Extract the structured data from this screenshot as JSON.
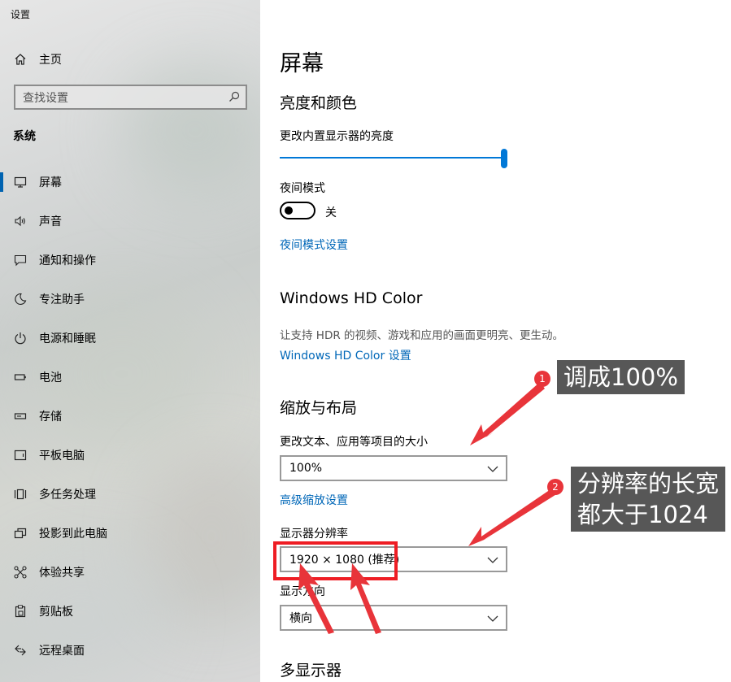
{
  "window": {
    "title": "设置"
  },
  "sidebar": {
    "home_label": "主页",
    "search_placeholder": "查找设置",
    "section_header": "系统",
    "items": [
      {
        "label": "屏幕",
        "icon": "monitor-icon",
        "active": true
      },
      {
        "label": "声音",
        "icon": "speaker-icon"
      },
      {
        "label": "通知和操作",
        "icon": "notification-icon"
      },
      {
        "label": "专注助手",
        "icon": "moon-icon"
      },
      {
        "label": "电源和睡眠",
        "icon": "power-icon"
      },
      {
        "label": "电池",
        "icon": "battery-icon"
      },
      {
        "label": "存储",
        "icon": "storage-icon"
      },
      {
        "label": "平板电脑",
        "icon": "tablet-icon"
      },
      {
        "label": "多任务处理",
        "icon": "multitasking-icon"
      },
      {
        "label": "投影到此电脑",
        "icon": "projection-icon"
      },
      {
        "label": "体验共享",
        "icon": "share-experience-icon"
      },
      {
        "label": "剪贴板",
        "icon": "clipboard-icon"
      },
      {
        "label": "远程桌面",
        "icon": "remote-desktop-icon"
      }
    ]
  },
  "main": {
    "title": "屏幕",
    "brightness": {
      "heading": "亮度和颜色",
      "label": "更改内置显示器的亮度",
      "value": 1.0
    },
    "night_light": {
      "label": "夜间模式",
      "state_label": "关",
      "settings_link": "夜间模式设置"
    },
    "hdr": {
      "heading": "Windows HD Color",
      "description": "让支持 HDR 的视频、游戏和应用的画面更明亮、更生动。",
      "link": "Windows HD Color 设置"
    },
    "scale_layout": {
      "heading": "缩放与布局",
      "scale_label": "更改文本、应用等项目的大小",
      "scale_value": "100%",
      "advanced_link": "高级缩放设置",
      "resolution_label": "显示器分辨率",
      "resolution_value": "1920 × 1080 (推荐)",
      "orientation_label": "显示方向",
      "orientation_value": "横向"
    },
    "multi_display": {
      "heading": "多显示器"
    }
  },
  "annotations": {
    "badge1": "1",
    "callout1": "调成100%",
    "badge2": "2",
    "callout2_line1": "分辨率的长宽",
    "callout2_line2": "都大于1024",
    "colors": {
      "arrow": "#e8343a",
      "callout_bg": "#575757",
      "highlight_box": "#ee1d24"
    }
  },
  "colors": {
    "accent": "#0078d7",
    "link": "#0067b8"
  }
}
